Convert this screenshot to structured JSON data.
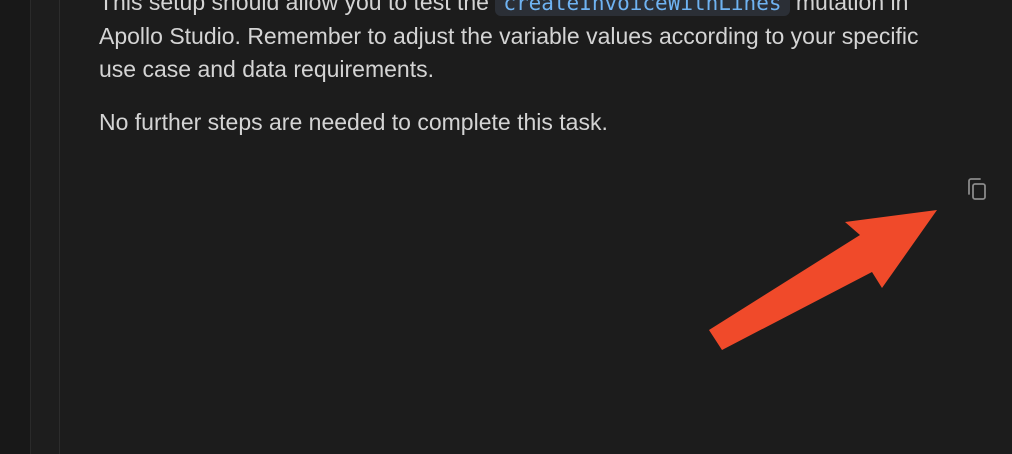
{
  "message": {
    "line1_prefix": "This setup should allow you to test the ",
    "code_mutation": "createInvoiceWithLines",
    "line1_suffix": " mutation in Apollo Studio. Remember to adjust the variable values according to your specific use case and data requirements.",
    "paragraph2": "No further steps are needed to complete this task."
  },
  "icons": {
    "copy": "copy-icon"
  },
  "colors": {
    "background": "#1c1c1c",
    "text": "#d4d4d4",
    "code_text": "#6fb3f2",
    "code_background": "#2b2f36",
    "annotation_arrow": "#f04a2a"
  }
}
